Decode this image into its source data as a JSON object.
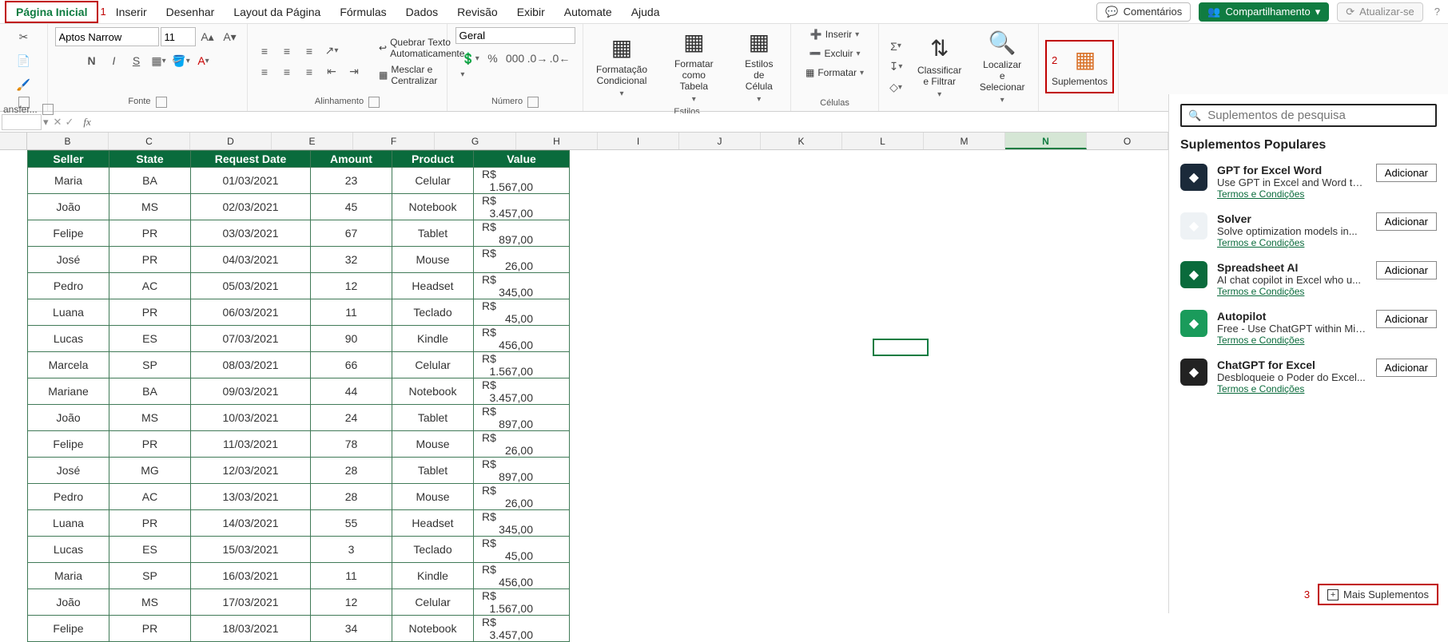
{
  "tabs": {
    "home": "Página Inicial",
    "insert": "Inserir",
    "draw": "Desenhar",
    "page_layout": "Layout da Página",
    "formulas": "Fórmulas",
    "data": "Dados",
    "review": "Revisão",
    "view": "Exibir",
    "automate": "Automate",
    "help": "Ajuda"
  },
  "top_right": {
    "comments": "Comentários",
    "share": "Compartilhamento",
    "refresh": "Atualizar-se"
  },
  "callouts": {
    "one": "1",
    "two": "2",
    "three": "3"
  },
  "ribbon": {
    "transfer": "ansfer...",
    "font_group": "Fonte",
    "font_name": "Aptos Narrow",
    "font_size": "11",
    "bold": "N",
    "italic": "I",
    "underline": "S",
    "align_group": "Alinhamento",
    "wrap": "Quebrar Texto Automaticamente",
    "merge": "Mesclar e Centralizar",
    "number_group": "Número",
    "number_format": "Geral",
    "styles_group": "Estilos",
    "cond_format": "Formatação\nCondicional",
    "format_table": "Formatar como\nTabela",
    "cell_styles": "Estilos de\nCélula",
    "cells_group": "Células",
    "insert": "Inserir",
    "delete": "Excluir",
    "format": "Formatar",
    "sort": "Classificar\ne Filtrar",
    "find": "Localizar e\nSelecionar",
    "addins": "Suplementos"
  },
  "cols": [
    "B",
    "C",
    "D",
    "E",
    "F",
    "G",
    "H",
    "I",
    "J",
    "K",
    "L",
    "M",
    "N",
    "O"
  ],
  "selected_col": "N",
  "table": {
    "headers": [
      "Seller",
      "State",
      "Request Date",
      "Amount",
      "Product",
      "Value"
    ],
    "rows": [
      [
        "Maria",
        "BA",
        "01/03/2021",
        "23",
        "Celular",
        "R$",
        "1.567,00"
      ],
      [
        "João",
        "MS",
        "02/03/2021",
        "45",
        "Notebook",
        "R$",
        "3.457,00"
      ],
      [
        "Felipe",
        "PR",
        "03/03/2021",
        "67",
        "Tablet",
        "R$",
        "897,00"
      ],
      [
        "José",
        "PR",
        "04/03/2021",
        "32",
        "Mouse",
        "R$",
        "26,00"
      ],
      [
        "Pedro",
        "AC",
        "05/03/2021",
        "12",
        "Headset",
        "R$",
        "345,00"
      ],
      [
        "Luana",
        "PR",
        "06/03/2021",
        "11",
        "Teclado",
        "R$",
        "45,00"
      ],
      [
        "Lucas",
        "ES",
        "07/03/2021",
        "90",
        "Kindle",
        "R$",
        "456,00"
      ],
      [
        "Marcela",
        "SP",
        "08/03/2021",
        "66",
        "Celular",
        "R$",
        "1.567,00"
      ],
      [
        "Mariane",
        "BA",
        "09/03/2021",
        "44",
        "Notebook",
        "R$",
        "3.457,00"
      ],
      [
        "João",
        "MS",
        "10/03/2021",
        "24",
        "Tablet",
        "R$",
        "897,00"
      ],
      [
        "Felipe",
        "PR",
        "11/03/2021",
        "78",
        "Mouse",
        "R$",
        "26,00"
      ],
      [
        "José",
        "MG",
        "12/03/2021",
        "28",
        "Tablet",
        "R$",
        "897,00"
      ],
      [
        "Pedro",
        "AC",
        "13/03/2021",
        "28",
        "Mouse",
        "R$",
        "26,00"
      ],
      [
        "Luana",
        "PR",
        "14/03/2021",
        "55",
        "Headset",
        "R$",
        "345,00"
      ],
      [
        "Lucas",
        "ES",
        "15/03/2021",
        "3",
        "Teclado",
        "R$",
        "45,00"
      ],
      [
        "Maria",
        "SP",
        "16/03/2021",
        "11",
        "Kindle",
        "R$",
        "456,00"
      ],
      [
        "João",
        "MS",
        "17/03/2021",
        "12",
        "Celular",
        "R$",
        "1.567,00"
      ],
      [
        "Felipe",
        "PR",
        "18/03/2021",
        "34",
        "Notebook",
        "R$",
        "3.457,00"
      ]
    ]
  },
  "panel": {
    "search_placeholder": "Suplementos de pesquisa",
    "title": "Suplementos Populares",
    "add": "Adicionar",
    "terms": "Termos e Condições",
    "more": "Mais Suplementos",
    "items": [
      {
        "title": "GPT for Excel Word",
        "desc": "Use GPT in Excel and Word to...",
        "bg": "#1b2a3a"
      },
      {
        "title": "Solver",
        "desc": "Solve optimization models in...",
        "bg": "#eef2f5"
      },
      {
        "title": "Spreadsheet AI",
        "desc": "AI chat copilot in Excel who u...",
        "bg": "#0a6b3c"
      },
      {
        "title": "Autopilot",
        "desc": "Free - Use ChatGPT within Mic...",
        "bg": "#1a9b5b"
      },
      {
        "title": "ChatGPT for Excel",
        "desc": "Desbloqueie o Poder do Excel...",
        "bg": "#222"
      }
    ]
  }
}
